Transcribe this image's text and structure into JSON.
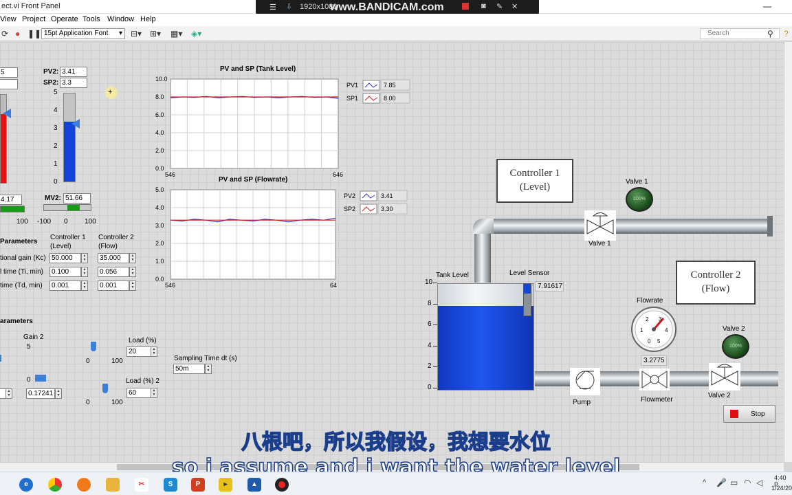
{
  "window": {
    "title": "ect.vi Front Panel"
  },
  "recorder": {
    "resolution": "1920x1080",
    "watermark": "www.BANDICAM.com"
  },
  "menu": [
    "View",
    "Project",
    "Operate",
    "Tools",
    "Window",
    "Help"
  ],
  "toolbar": {
    "font": "15pt Application Font",
    "search_placeholder": "Search"
  },
  "left": {
    "sp1_partial": "5",
    "pv2_label": "PV2:",
    "pv2": "3.41",
    "sp2_label": "SP2:",
    "sp2": "3.3",
    "slider_ticks": [
      "5",
      "4",
      "3",
      "2",
      "1",
      "0"
    ],
    "mv1_partial": "4.17",
    "mv2_label": "MV2:",
    "mv2": "51.66",
    "mv_ticks": [
      "100",
      "-100",
      "0",
      "100"
    ]
  },
  "params": {
    "title": "Parameters",
    "col1": [
      "Controller 1",
      "(Level)"
    ],
    "col2": [
      "Controller 2",
      "(Flow)"
    ],
    "rows": [
      {
        "label": "tional gain (Kc)",
        "v1": "50.000",
        "v2": "35.000"
      },
      {
        "label": "l time (Ti, min)",
        "v1": "0.100",
        "v2": "0.056"
      },
      {
        "label": "time (Td, min)",
        "v1": "0.001",
        "v2": "0.001"
      }
    ]
  },
  "process": {
    "title": "arameters",
    "gain2_label": "Gain 2",
    "gain2_tick": "5",
    "gain2_zero": "0",
    "gain2_value": "0.17241",
    "load1_label": "Load (%)",
    "load1": "20",
    "load1_ticks": [
      "0",
      "100"
    ],
    "load2_label": "Load (%) 2",
    "load2": "60",
    "load2_ticks": [
      "0",
      "100"
    ],
    "dt_label": "Sampling Time dt (s)",
    "dt": "50m"
  },
  "chart1": {
    "title": "PV and SP (Tank Level)",
    "yticks": [
      "10.0",
      "8.0",
      "6.0",
      "4.0",
      "2.0",
      "0.0"
    ],
    "xmin": "546",
    "xmax": "646",
    "legend": [
      {
        "name": "PV1",
        "value": "7.85"
      },
      {
        "name": "SP1",
        "value": "8.00"
      }
    ]
  },
  "chart2": {
    "title": "PV and SP (Flowrate)",
    "yticks": [
      "5.0",
      "4.0",
      "3.0",
      "2.0",
      "1.0",
      "0.0"
    ],
    "xmin": "546",
    "xmax": "64",
    "legend": [
      {
        "name": "PV2",
        "value": "3.41"
      },
      {
        "name": "SP2",
        "value": "3.30"
      }
    ]
  },
  "chart_data": [
    {
      "type": "line",
      "title": "PV and SP (Tank Level)",
      "x_range": [
        546,
        646
      ],
      "ylim": [
        0,
        10
      ],
      "series": [
        {
          "name": "PV1",
          "values": [
            7.9,
            8.0,
            7.95,
            8.05,
            7.9,
            8.0,
            8.05,
            7.95,
            8.0,
            7.9,
            8.0,
            8.05,
            7.95,
            8.0,
            7.85
          ]
        },
        {
          "name": "SP1",
          "values": [
            8,
            8,
            8,
            8,
            8,
            8,
            8,
            8,
            8,
            8,
            8,
            8,
            8,
            8,
            8
          ]
        }
      ]
    },
    {
      "type": "line",
      "title": "PV and SP (Flowrate)",
      "x_range": [
        546,
        646
      ],
      "ylim": [
        0,
        5
      ],
      "series": [
        {
          "name": "PV2",
          "values": [
            3.3,
            3.25,
            3.35,
            3.3,
            3.2,
            3.35,
            3.3,
            3.25,
            3.35,
            3.3,
            3.2,
            3.3,
            3.35,
            3.3,
            3.41
          ]
        },
        {
          "name": "SP2",
          "values": [
            3.3,
            3.3,
            3.3,
            3.3,
            3.3,
            3.3,
            3.3,
            3.3,
            3.3,
            3.3,
            3.3,
            3.3,
            3.3,
            3.3,
            3.3
          ]
        }
      ]
    }
  ],
  "plant": {
    "controller1": [
      "Controller 1",
      "(Level)"
    ],
    "controller2": [
      "Controller 2",
      "(Flow)"
    ],
    "valve1": "Valve 1",
    "valve1_led": "Valve 1",
    "valve1_pct": "100%",
    "valve2": "Valve 2",
    "valve2_led": "Valve 2",
    "valve2_pct": "100%",
    "tank_label": "Tank Level",
    "tank_ticks": [
      "10",
      "8",
      "6",
      "4",
      "2",
      "0"
    ],
    "tank_fill": 0.79,
    "sensor_label": "Level Sensor",
    "sensor_value": "7.91617",
    "flowrate_label": "Flowrate",
    "gauge_ticks": [
      "1",
      "2",
      "3",
      "4",
      "5",
      "0"
    ],
    "flow_value": "3.2775",
    "pump": "Pump",
    "flowmeter": "Flowmeter",
    "stop": "Stop"
  },
  "subtitles": {
    "zh": "八根吧，所以我假设，我想要水位",
    "en": "so i assume and i want the water level"
  },
  "clock": {
    "time": "4:40 P",
    "date": "1/24/20"
  }
}
